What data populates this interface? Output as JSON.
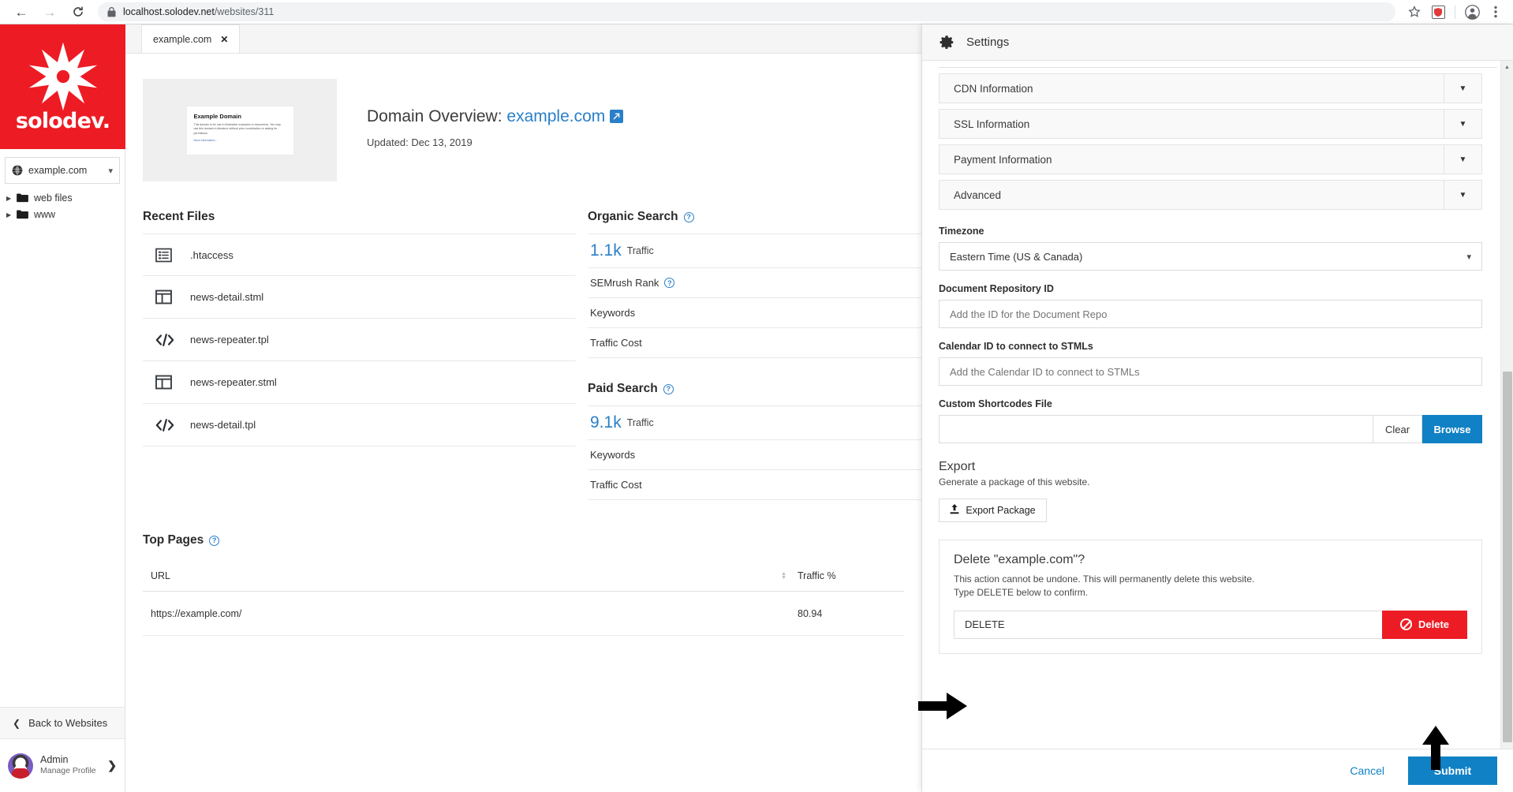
{
  "browser": {
    "back_icon": "back-arrow-icon",
    "forward_icon": "forward-arrow-icon",
    "reload_icon": "reload-icon",
    "lock_icon": "lock-icon",
    "url_host": "localhost.solodev.net",
    "url_path": "/websites/311",
    "bookmark_icon": "star-icon",
    "extension_icon": "extension-shield-icon",
    "profile_icon": "profile-avatar-icon",
    "menu_icon": "three-dot-menu-icon"
  },
  "sidebar": {
    "logo_text": "solodev.",
    "logo_bg": "#ed1c24",
    "site_selector": {
      "label": "example.com",
      "icon": "globe-icon",
      "caret": "chevron-down-icon"
    },
    "tree": [
      {
        "label": "web files",
        "icon": "folder-icon",
        "arrow": "triangle-right-icon"
      },
      {
        "label": "www",
        "icon": "folder-icon",
        "arrow": "triangle-right-icon"
      }
    ],
    "back_label": "Back to Websites",
    "back_icon": "chevron-left-icon",
    "profile": {
      "name": "Admin",
      "subtitle": "Manage Profile",
      "avatar": "panda-avatar",
      "chevron": "chevron-right-icon"
    }
  },
  "main": {
    "tab": {
      "label": "example.com",
      "close_icon": "close-x-icon"
    },
    "thumbnail": {
      "title": "Example Domain",
      "body": "This domain is for use in illustrative examples in documents. You may use this domain in literature without prior coordination or asking for permission.",
      "link": "More information..."
    },
    "overview": {
      "prefix": "Domain Overview: ",
      "domain": "example.com",
      "external_icon": "external-link-icon",
      "updated": "Updated: Dec 13, 2019"
    },
    "recent_files": {
      "title": "Recent Files",
      "items": [
        {
          "name": ".htaccess",
          "icon": "list-file-icon"
        },
        {
          "name": "news-detail.stml",
          "icon": "layout-columns-icon"
        },
        {
          "name": "news-repeater.tpl",
          "icon": "code-brackets-icon"
        },
        {
          "name": "news-repeater.stml",
          "icon": "layout-columns-icon"
        },
        {
          "name": "news-detail.tpl",
          "icon": "code-brackets-icon"
        }
      ]
    },
    "organic_search": {
      "title": "Organic Search",
      "help_icon": "help-circle-icon",
      "traffic_value": "1.1k",
      "traffic_label": "Traffic",
      "rows": [
        {
          "label": "SEMrush Rank",
          "has_help": true
        },
        {
          "label": "Keywords",
          "has_help": false
        },
        {
          "label": "Traffic Cost",
          "has_help": false
        }
      ]
    },
    "paid_search": {
      "title": "Paid Search",
      "help_icon": "help-circle-icon",
      "traffic_value": "9.1k",
      "traffic_label": "Traffic",
      "rows": [
        {
          "label": "Keywords",
          "has_help": false
        },
        {
          "label": "Traffic Cost",
          "has_help": false
        }
      ]
    },
    "top_pages": {
      "title": "Top Pages",
      "help_icon": "help-circle-icon",
      "columns": [
        "URL",
        "Traffic %"
      ],
      "sort_icon": "sort-arrows-icon",
      "rows": [
        {
          "url": "https://example.com/",
          "traffic": "80.94"
        }
      ]
    }
  },
  "settings": {
    "title": "Settings",
    "gear_icon": "gear-icon",
    "accordions": [
      {
        "label": "CDN Information",
        "caret": "caret-down-icon"
      },
      {
        "label": "SSL Information",
        "caret": "caret-down-icon"
      },
      {
        "label": "Payment Information",
        "caret": "caret-down-icon"
      },
      {
        "label": "Advanced",
        "caret": "caret-down-icon"
      }
    ],
    "advanced": {
      "timezone_label": "Timezone",
      "timezone_value": "Eastern Time (US & Canada)",
      "timezone_caret": "chevron-down-icon",
      "doc_repo_label": "Document Repository ID",
      "doc_repo_placeholder": "Add the ID for the Document Repo",
      "calendar_label": "Calendar ID to connect to STMLs",
      "calendar_placeholder": "Add the Calendar ID to connect to STMLs",
      "shortcodes_label": "Custom Shortcodes File",
      "shortcodes_value": "",
      "clear_label": "Clear",
      "browse_label": "Browse",
      "export_title": "Export",
      "export_sub": "Generate a package of this website.",
      "export_button": "Export Package",
      "export_icon": "upload-icon"
    },
    "delete": {
      "title": "Delete \"example.com\"?",
      "description_line1": "This action cannot be undone. This will permanently delete this website.",
      "description_line2": "Type DELETE below to confirm.",
      "input_value": "DELETE",
      "button_label": "Delete",
      "button_icon": "ban-icon",
      "button_color": "#ed1c24"
    },
    "footer": {
      "cancel_label": "Cancel",
      "submit_label": "Submit",
      "submit_color": "#1081c4"
    },
    "scrollbar": {
      "up_icon": "scroll-up-arrow-icon"
    }
  },
  "annotations": [
    {
      "name": "arrow-pointing-to-delete-input",
      "direction": "right"
    },
    {
      "name": "arrow-pointing-to-delete-button",
      "direction": "up"
    }
  ]
}
